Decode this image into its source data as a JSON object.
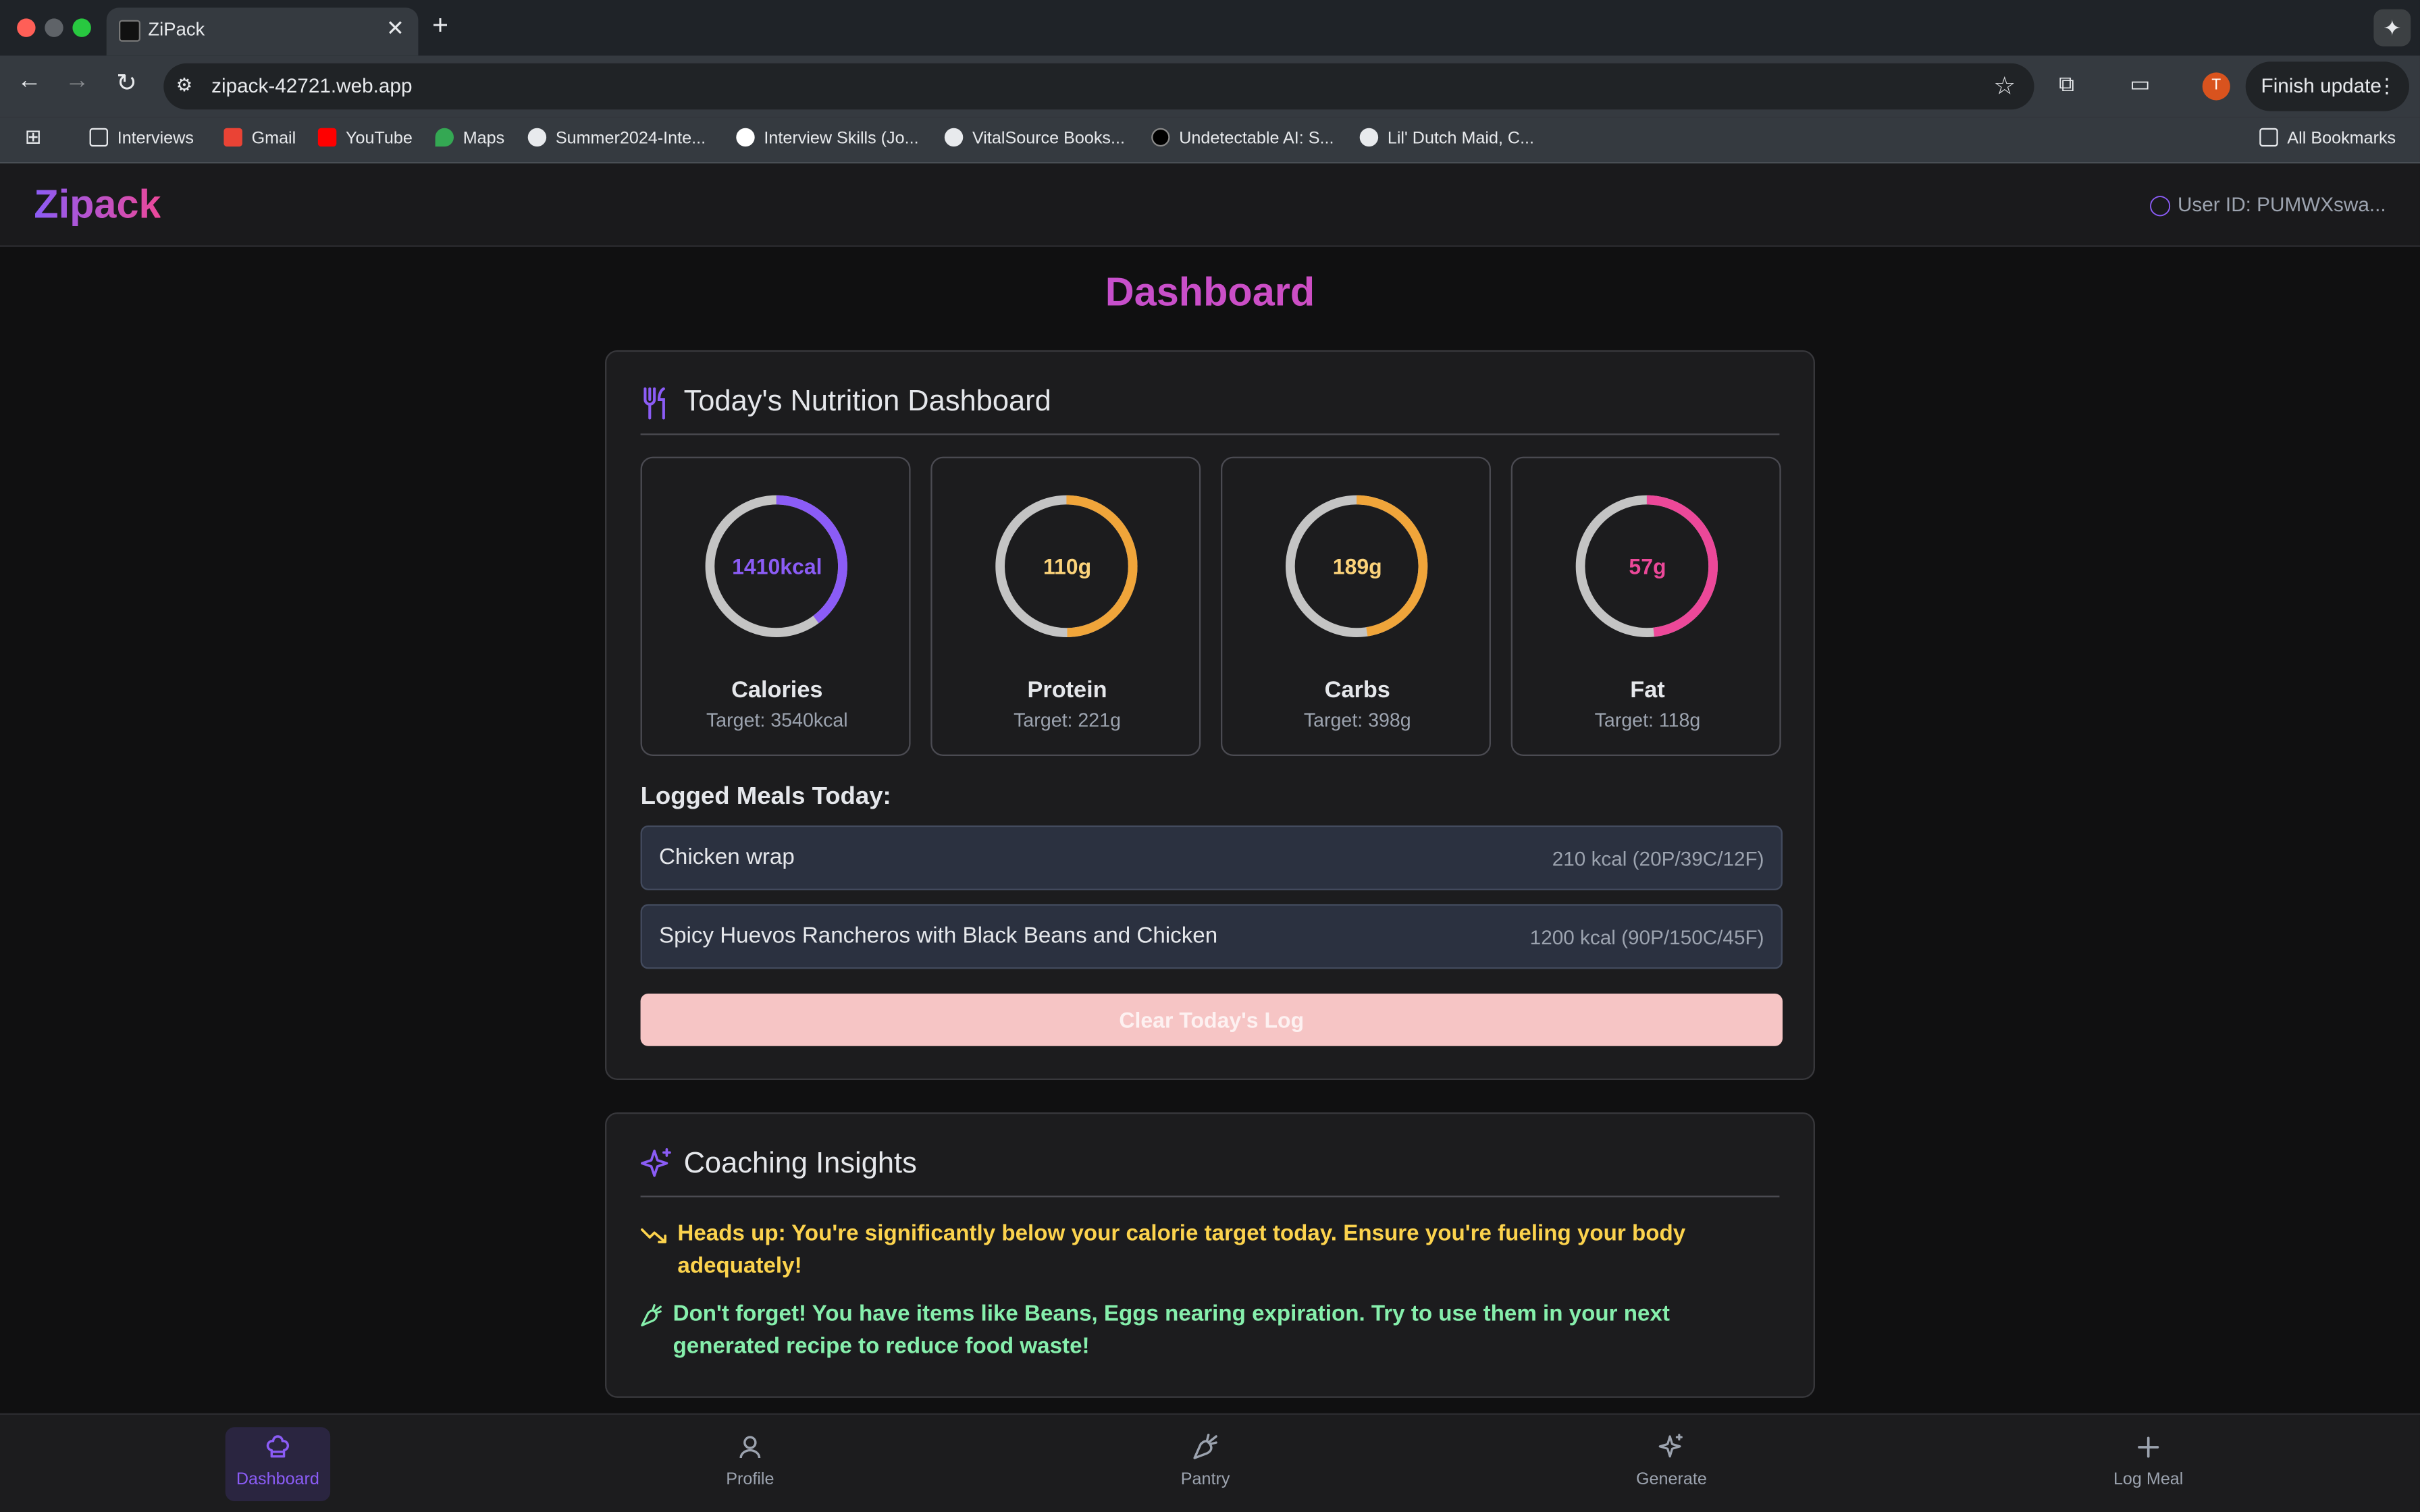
{
  "browser": {
    "tab_title": "ZiPack",
    "new_tab": "+",
    "tab_close": "✕",
    "url": "zipack-42721.web.app",
    "profile_initial": "T",
    "finish_update": "Finish update",
    "bookmarks": [
      {
        "label": "Interviews",
        "icon": "folder-icon"
      },
      {
        "label": "Gmail",
        "icon": "gmail-icon"
      },
      {
        "label": "YouTube",
        "icon": "youtube-icon"
      },
      {
        "label": "Maps",
        "icon": "maps-icon"
      },
      {
        "label": "Summer2024-Inte...",
        "icon": "github-icon"
      },
      {
        "label": "Interview Skills (Jo...",
        "icon": "site-icon"
      },
      {
        "label": "VitalSource Books...",
        "icon": "globe-icon"
      },
      {
        "label": "Undetectable AI: S...",
        "icon": "site-icon"
      },
      {
        "label": "Lil' Dutch Maid, C...",
        "icon": "globe-icon"
      }
    ],
    "all_bookmarks": "All Bookmarks"
  },
  "app": {
    "logo": "Zipack",
    "user_id": "User ID: PUMWXswa..."
  },
  "page": {
    "title": "Dashboard"
  },
  "nutrition": {
    "title": "Today's Nutrition Dashboard",
    "macros": [
      {
        "name": "Calories",
        "value": "1410kcal",
        "target": "Target: 3540kcal",
        "progress": 0.398,
        "color": "#8b5cf6"
      },
      {
        "name": "Protein",
        "value": "110g",
        "target": "Target: 221g",
        "progress": 0.498,
        "color": "#f0a53a"
      },
      {
        "name": "Carbs",
        "value": "189g",
        "target": "Target: 398g",
        "progress": 0.475,
        "color": "#f0a53a"
      },
      {
        "name": "Fat",
        "value": "57g",
        "target": "Target: 118g",
        "progress": 0.483,
        "color": "#ec4899"
      }
    ],
    "logged_label": "Logged Meals Today:",
    "meals": [
      {
        "name": "Chicken wrap",
        "info": "210 kcal (20P/39C/12F)"
      },
      {
        "name": "Spicy Huevos Rancheros with Black Beans and Chicken",
        "info": "1200 kcal (90P/150C/45F)"
      }
    ],
    "clear_label": "Clear Today's Log"
  },
  "coaching": {
    "title": "Coaching Insights",
    "insights": [
      {
        "text": "Heads up: You're significantly below your calorie target today. Ensure you're fueling your body adequately!",
        "color": "#fcd34d",
        "icon": "trending-down-icon"
      },
      {
        "text": "Don't forget! You have items like Beans, Eggs nearing expiration. Try to use them in your next generated recipe to reduce food waste!",
        "color": "#86efac",
        "icon": "carrot-icon"
      }
    ]
  },
  "nav": [
    {
      "label": "Dashboard",
      "icon": "chef-hat-icon",
      "active": true
    },
    {
      "label": "Profile",
      "icon": "user-icon",
      "active": false
    },
    {
      "label": "Pantry",
      "icon": "carrot-icon",
      "active": false
    },
    {
      "label": "Generate",
      "icon": "sparkles-icon",
      "active": false
    },
    {
      "label": "Log Meal",
      "icon": "plus-icon",
      "active": false
    }
  ]
}
